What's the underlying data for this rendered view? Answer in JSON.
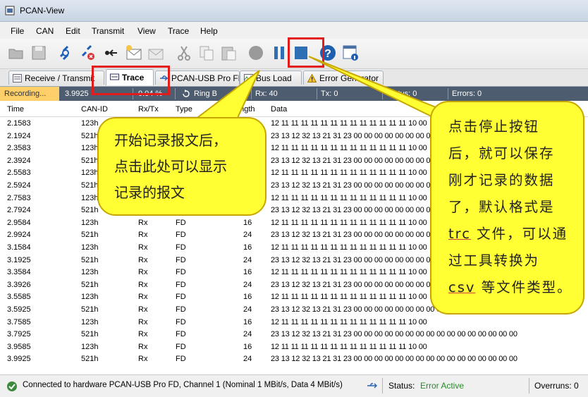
{
  "window": {
    "title": "PCAN-View"
  },
  "menu": [
    "File",
    "CAN",
    "Edit",
    "Transmit",
    "View",
    "Trace",
    "Help"
  ],
  "toolbar_icons": [
    "open-folder-icon",
    "save-icon",
    "connect-icon",
    "disconnect-icon",
    "reset-icon",
    "new-message-icon",
    "edit-message-icon",
    "cut-icon",
    "copy-icon",
    "paste-icon",
    "record-icon",
    "pause-icon",
    "stop-icon",
    "help-icon",
    "info-icon"
  ],
  "tabs": [
    {
      "label": "Receive / Transmit",
      "icon": "receive-transmit-icon"
    },
    {
      "label": "Trace",
      "icon": "trace-icon"
    },
    {
      "label": "PCAN-USB Pro FD",
      "icon": "usb-icon"
    },
    {
      "label": "Bus Load",
      "icon": "busload-icon"
    },
    {
      "label": "Error Generator",
      "icon": "warning-icon"
    }
  ],
  "trace_status": {
    "state": "Recording...",
    "time": "3.9925",
    "buffer": "0.04 %",
    "ring_buffer": "Ring B",
    "rx": "Rx: 40",
    "tx": "Tx: 0",
    "status": "Status: 0",
    "errors": "Errors: 0"
  },
  "columns": {
    "time": "Time",
    "can_id": "CAN-ID",
    "rxtx": "Rx/Tx",
    "type": "Type",
    "length": "ength",
    "data": "Data"
  },
  "rows": [
    {
      "time": "2.1583",
      "id": "123h",
      "dir": "Rx",
      "type": "FD",
      "len": "16",
      "data": "12 11 11 11 11 11 11 11 11 11 11 11 11 11 10 00"
    },
    {
      "time": "2.1924",
      "id": "521h",
      "dir": "Rx",
      "type": "FD",
      "len": "24",
      "data": "23 13 12 32 13 21 31 23 00 00 00 00 00 00 00 00 00 00 00 00 00 00 00 00"
    },
    {
      "time": "2.3583",
      "id": "123h",
      "dir": "Rx",
      "type": "FD",
      "len": "16",
      "data": "12 11 11 11 11 11 11 11 11 11 11 11 11 11 10 00"
    },
    {
      "time": "2.3924",
      "id": "521h",
      "dir": "Rx",
      "type": "FD",
      "len": "24",
      "data": "23 13 12 32 13 21 31 23 00 00 00 00 00 00 00 00 00 00 00 00 00 00 00 00"
    },
    {
      "time": "2.5583",
      "id": "123h",
      "dir": "Rx",
      "type": "FD",
      "len": "16",
      "data": "12 11 11 11 11 11 11 11 11 11 11 11 11 11 10 00"
    },
    {
      "time": "2.5924",
      "id": "521h",
      "dir": "Rx",
      "type": "FD",
      "len": "24",
      "data": "23 13 12 32 13 21 31 23 00 00 00 00 00 00 00 00 00 00 00 00 00 00 00 00"
    },
    {
      "time": "2.7583",
      "id": "123h",
      "dir": "Rx",
      "type": "FD",
      "len": "16",
      "data": "12 11 11 11 11 11 11 11 11 11 11 11 11 11 10 00"
    },
    {
      "time": "2.7924",
      "id": "521h",
      "dir": "Rx",
      "type": "FD",
      "len": "24",
      "data": "23 13 12 32 13 21 31 23 00 00 00 00 00 00 00 00 00 00 00 00 00 00 00 00"
    },
    {
      "time": "2.9584",
      "id": "123h",
      "dir": "Rx",
      "type": "FD",
      "len": "16",
      "data": "12 11 11 11 11 11 11 11 11 11 11 11 11 11 10 00"
    },
    {
      "time": "2.9924",
      "id": "521h",
      "dir": "Rx",
      "type": "FD",
      "len": "24",
      "data": "23 13 12 32 13 21 31 23 00 00 00 00 00 00 00 00 00 00 00 00 00 00 00 00"
    },
    {
      "time": "3.1584",
      "id": "123h",
      "dir": "Rx",
      "type": "FD",
      "len": "16",
      "data": "12 11 11 11 11 11 11 11 11 11 11 11 11 11 10 00"
    },
    {
      "time": "3.1925",
      "id": "521h",
      "dir": "Rx",
      "type": "FD",
      "len": "24",
      "data": "23 13 12 32 13 21 31 23 00 00 00 00 00 00 00 00 00 00 00 00 00 00 00 00"
    },
    {
      "time": "3.3584",
      "id": "123h",
      "dir": "Rx",
      "type": "FD",
      "len": "16",
      "data": "12 11 11 11 11 11 11 11 11 11 11 11 11 11 10 00"
    },
    {
      "time": "3.3926",
      "id": "521h",
      "dir": "Rx",
      "type": "FD",
      "len": "24",
      "data": "23 13 12 32 13 21 31 23 00 00 00 00 00 00 00 00 00 00 00 00 00 00 00 00"
    },
    {
      "time": "3.5585",
      "id": "123h",
      "dir": "Rx",
      "type": "FD",
      "len": "16",
      "data": "12 11 11 11 11 11 11 11 11 11 11 11 11 11 10 00"
    },
    {
      "time": "3.5925",
      "id": "521h",
      "dir": "Rx",
      "type": "FD",
      "len": "24",
      "data": "23 13 12 32 13 21 31 23 00 00 00 00 00 00 00 00 00 00 00 00 00 00 00 00"
    },
    {
      "time": "3.7585",
      "id": "123h",
      "dir": "Rx",
      "type": "FD",
      "len": "16",
      "data": "12 11 11 11 11 11 11 11 11 11 11 11 11 11 10 00"
    },
    {
      "time": "3.7925",
      "id": "521h",
      "dir": "Rx",
      "type": "FD",
      "len": "24",
      "data": "23 13 12 32 13 21 31 23 00 00 00 00 00 00 00 00 00 00 00 00 00 00 00 00"
    },
    {
      "time": "3.9585",
      "id": "123h",
      "dir": "Rx",
      "type": "FD",
      "len": "16",
      "data": "12 11 11 11 11 11 11 11 11 11 11 11 11 11 10 00"
    },
    {
      "time": "3.9925",
      "id": "521h",
      "dir": "Rx",
      "type": "FD",
      "len": "24",
      "data": "23 13 12 32 13 21 31 23 00 00 00 00 00 00 00 00 00 00 00 00 00 00 00 00"
    }
  ],
  "statusbar": {
    "connection": "Connected to hardware PCAN-USB Pro FD, Channel 1 (Nominal 1 MBit/s, Data 4 MBit/s)",
    "status_label": "Status:",
    "status_value": "Error Active",
    "overruns": "Overruns: 0"
  },
  "callouts": {
    "left_lines": [
      "开始记录报文后，",
      "点击此处可以显示",
      "记录的报文"
    ],
    "right_lines": [
      "点击停止按钮",
      "后，就可以保存",
      "刚才记录的数据",
      "了，默认格式是"
    ],
    "right_trc": "trc",
    "right_line5_rest": " 文件，可以通",
    "right_line6": "过工具转换为",
    "right_csv": "csv",
    "right_line7_rest": " 等文件类型。"
  },
  "colors": {
    "highlight": "#e21b1b",
    "callout": "#ffff33",
    "status_ok": "#2a8a2a",
    "status_strip": "#4d5c6f"
  }
}
